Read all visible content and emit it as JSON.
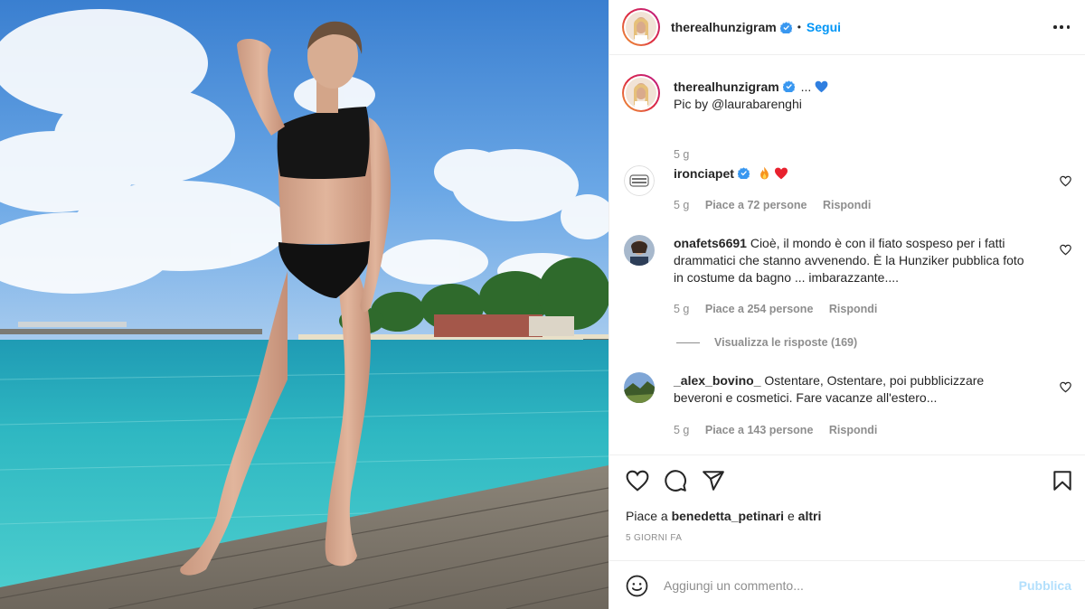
{
  "post": {
    "author": "therealhunzigram",
    "follow_label": "Segui",
    "separator": "•",
    "caption_text": "...",
    "caption_emoji": "blue-heart",
    "caption_line2": "Pic by @laurabarenghi",
    "caption_age": "5 g"
  },
  "comments": [
    {
      "user": "ironciapet",
      "verified": true,
      "text": "",
      "emojis": [
        "fire",
        "red-heart"
      ],
      "age": "5 g",
      "likes": "Piace a 72 persone",
      "reply": "Rispondi"
    },
    {
      "user": "onafets6691",
      "verified": false,
      "text": "Cioè, il mondo è con il fiato sospeso per i fatti drammatici che stanno avvenendo. È la Hunziker pubblica foto in costume da bagno ... imbarazzante....",
      "age": "5 g",
      "likes": "Piace a 254 persone",
      "reply": "Rispondi"
    },
    {
      "user": "_alex_bovino_",
      "verified": false,
      "text": "Ostentare, Ostentare, poi pubblicizzare beveroni e cosmetici. Fare vacanze all'estero...",
      "age": "5 g",
      "likes": "Piace a 143 persone",
      "reply": "Rispondi"
    }
  ],
  "view_replies": "Visualizza le risposte (169)",
  "likes_line": {
    "prefix": "Piace a",
    "user": "benedetta_petinari",
    "conj": "e",
    "others": "altri"
  },
  "posted_time": "5 GIORNI FA",
  "add_comment": {
    "placeholder": "Aggiungi un commento...",
    "publish_label": "Pubblica"
  },
  "colors": {
    "link_blue": "#0095f6",
    "publish_disabled": "#b2dffc",
    "muted_text": "#8e8e8e",
    "verified_blue": "#3897f0"
  },
  "icons": [
    "verified-badge-icon",
    "more-options-icon",
    "heart-icon",
    "comment-icon",
    "share-icon",
    "bookmark-icon",
    "emoji-smile-icon",
    "blue-heart-emoji",
    "fire-emoji",
    "red-heart-emoji"
  ]
}
